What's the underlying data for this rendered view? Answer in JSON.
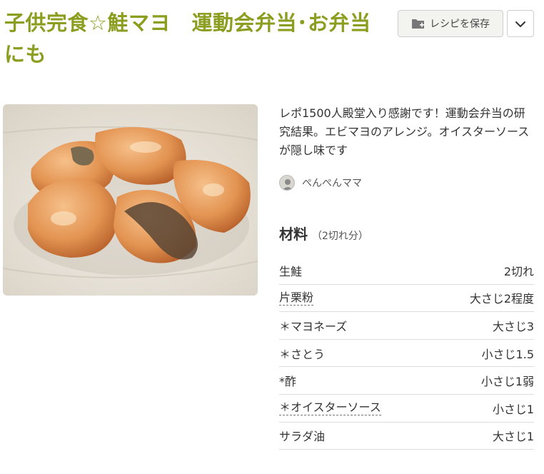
{
  "recipe": {
    "title": "子供完食☆鮭マヨ　運動会弁当･お弁当にも",
    "save_label": "レシピを保存",
    "description": "レポ1500人殿堂入り感謝です！運動会弁当の研究結果。エビマヨのアレンジ。オイスターソースが隠し味です",
    "author": "ぺんぺんママ"
  },
  "ingredients": {
    "heading": "材料",
    "serving": "（2切れ分）",
    "items": [
      {
        "name": "生鮭",
        "qty": "2切れ",
        "linked": false
      },
      {
        "name": "片栗粉",
        "qty": "大さじ2程度",
        "linked": true
      },
      {
        "name": "＊マヨネーズ",
        "qty": "大さじ3",
        "linked": false
      },
      {
        "name": "＊さとう",
        "qty": "小さじ1.5",
        "linked": false
      },
      {
        "name": "*酢",
        "qty": "小さじ1弱",
        "linked": false
      },
      {
        "name": "＊オイスターソース",
        "qty": "小さじ1",
        "linked": true
      },
      {
        "name": "サラダ油",
        "qty": "大さじ1",
        "linked": false
      }
    ]
  },
  "colors": {
    "title": "#8c9e1f"
  },
  "icons": {
    "save": "folder-plus-icon",
    "more": "chevron-down-icon"
  }
}
